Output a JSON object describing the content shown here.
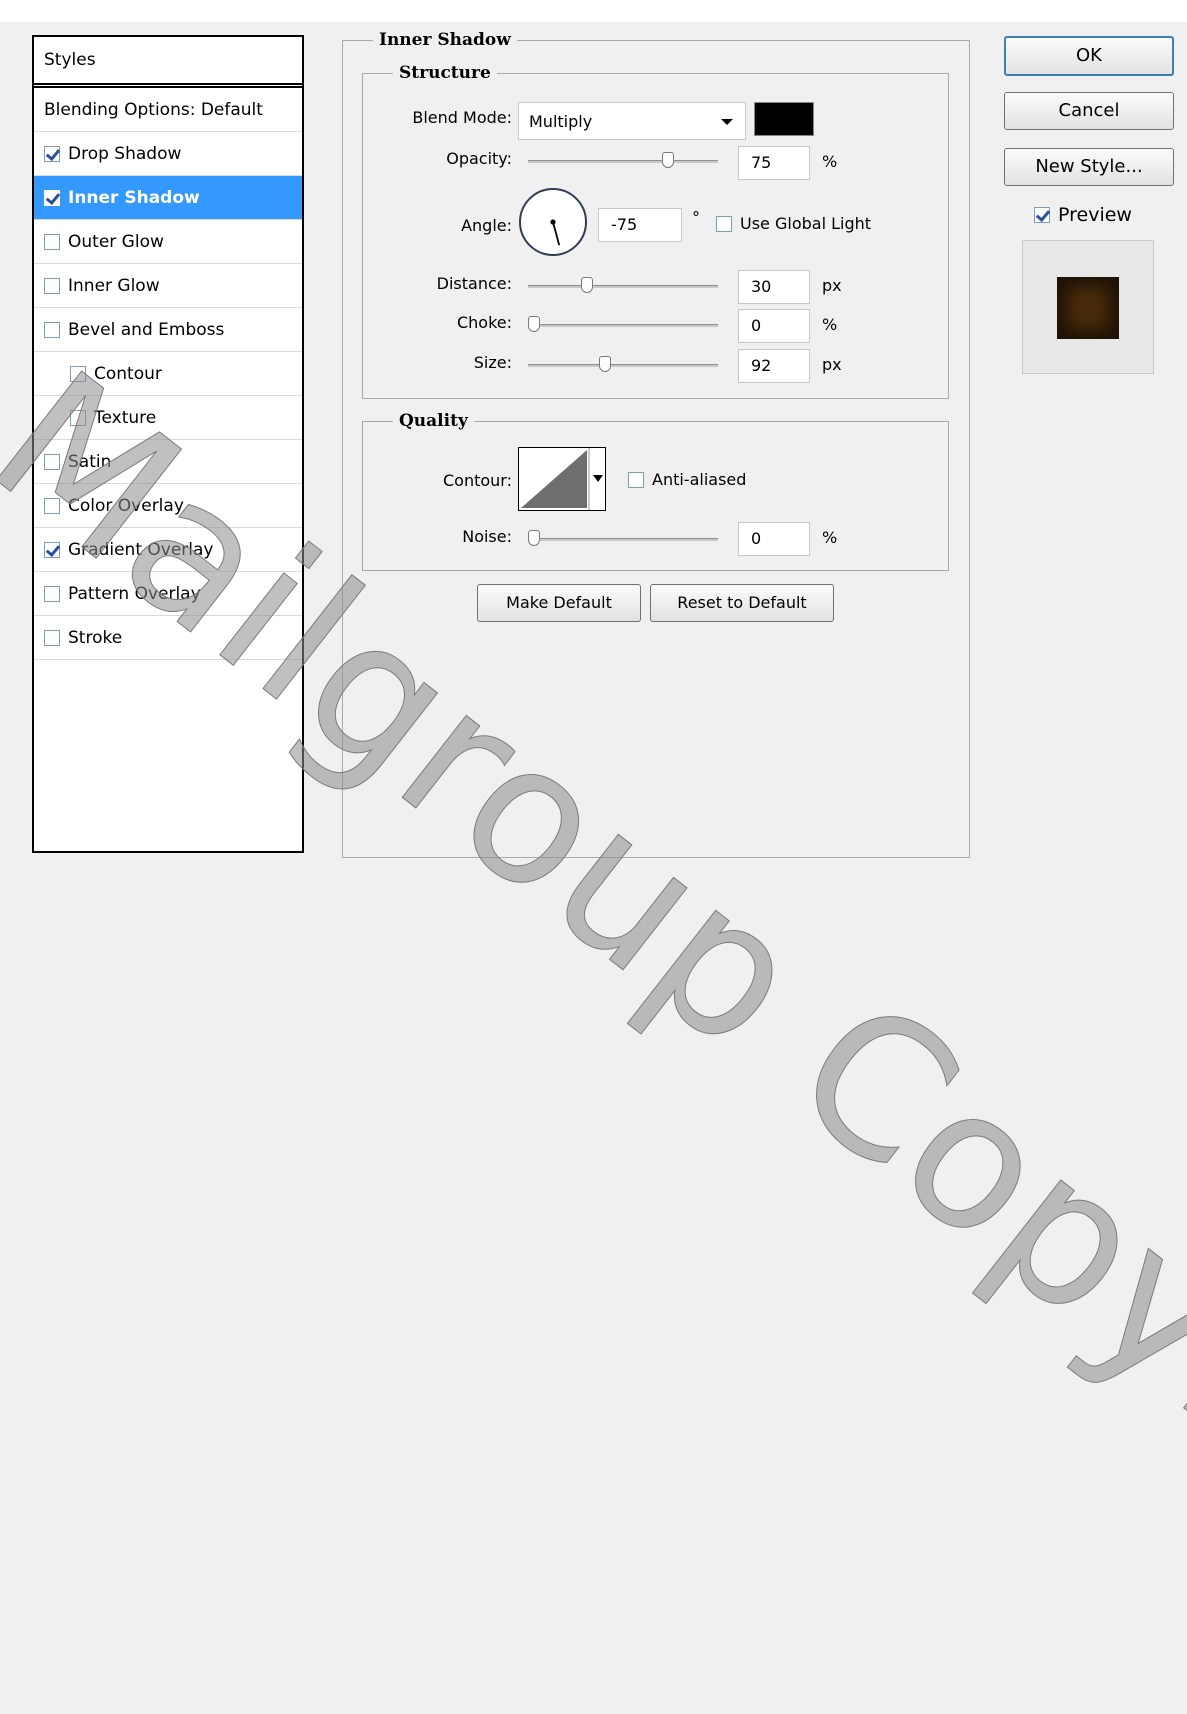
{
  "styles_panel": {
    "header": "Styles",
    "items": [
      {
        "label": "Blending Options: Default",
        "checkbox": false,
        "checked": false,
        "selected": false,
        "indent": false
      },
      {
        "label": "Drop Shadow",
        "checkbox": true,
        "checked": true,
        "selected": false,
        "indent": false
      },
      {
        "label": "Inner Shadow",
        "checkbox": true,
        "checked": true,
        "selected": true,
        "indent": false
      },
      {
        "label": "Outer Glow",
        "checkbox": true,
        "checked": false,
        "selected": false,
        "indent": false
      },
      {
        "label": "Inner Glow",
        "checkbox": true,
        "checked": false,
        "selected": false,
        "indent": false
      },
      {
        "label": "Bevel and Emboss",
        "checkbox": true,
        "checked": false,
        "selected": false,
        "indent": false
      },
      {
        "label": "Contour",
        "checkbox": true,
        "checked": false,
        "selected": false,
        "indent": true
      },
      {
        "label": "Texture",
        "checkbox": true,
        "checked": false,
        "selected": false,
        "indent": true
      },
      {
        "label": "Satin",
        "checkbox": true,
        "checked": false,
        "selected": false,
        "indent": false
      },
      {
        "label": "Color Overlay",
        "checkbox": true,
        "checked": false,
        "selected": false,
        "indent": false
      },
      {
        "label": "Gradient Overlay",
        "checkbox": true,
        "checked": true,
        "selected": false,
        "indent": false
      },
      {
        "label": "Pattern Overlay",
        "checkbox": true,
        "checked": false,
        "selected": false,
        "indent": false
      },
      {
        "label": "Stroke",
        "checkbox": true,
        "checked": false,
        "selected": false,
        "indent": false
      }
    ]
  },
  "inner_shadow": {
    "title": "Inner Shadow",
    "structure": {
      "title": "Structure",
      "blend_mode": {
        "label": "Blend Mode:",
        "value": "Multiply",
        "color": "#000000"
      },
      "opacity": {
        "label": "Opacity:",
        "value": "75",
        "unit": "%",
        "slider_fraction": 0.75
      },
      "angle": {
        "label": "Angle:",
        "value": "-75",
        "unit": "°",
        "degrees": -75,
        "global_light_label": "Use Global Light",
        "global_light_checked": false
      },
      "distance": {
        "label": "Distance:",
        "value": "30",
        "unit": "px",
        "slider_fraction": 0.3
      },
      "choke": {
        "label": "Choke:",
        "value": "0",
        "unit": "%",
        "slider_fraction": 0.0
      },
      "size": {
        "label": "Size:",
        "value": "92",
        "unit": "px",
        "slider_fraction": 0.4
      }
    },
    "quality": {
      "title": "Quality",
      "contour": {
        "label": "Contour:",
        "anti_aliased_label": "Anti-aliased",
        "anti_aliased_checked": false
      },
      "noise": {
        "label": "Noise:",
        "value": "0",
        "unit": "%",
        "slider_fraction": 0.0
      }
    },
    "make_default_label": "Make Default",
    "reset_default_label": "Reset to Default"
  },
  "buttons": {
    "ok_label": "OK",
    "cancel_label": "Cancel",
    "new_style_label": "New Style...",
    "preview_label": "Preview",
    "preview_checked": true
  },
  "preview_color": "#4a2c0c",
  "watermark": "Mailgroup Copyright"
}
